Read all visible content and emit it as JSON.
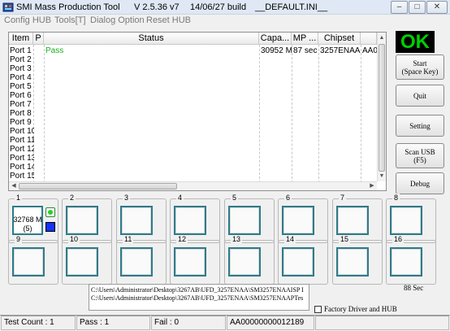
{
  "window": {
    "title": "SMI Mass Production Tool",
    "version": "V 2.5.36  v7",
    "build": "14/06/27 build",
    "ini": "__DEFAULT.INI__"
  },
  "menu": [
    "Config HUB",
    "Tools[T]",
    "Dialog Option",
    "Reset HUB"
  ],
  "table": {
    "headers": [
      "Item",
      "P",
      "Status",
      "Capa...",
      "MP ...",
      "Chipset",
      "▲"
    ],
    "ports": [
      "Port 1",
      "Port 2",
      "Port 3",
      "Port 4",
      "Port 5",
      "Port 6",
      "Port 7",
      "Port 8",
      "Port 9",
      "Port 10",
      "Port 11",
      "Port 12",
      "Port 13",
      "Port 14",
      "Port 15"
    ],
    "row1": {
      "status": "Pass",
      "capacity": "30952 M",
      "mp_time": "87 sec",
      "chipset": "3257ENAA",
      "extra": "AA0"
    }
  },
  "result": {
    "text": "OK",
    "color": "#00d000"
  },
  "buttons": {
    "start": "Start\n(Space Key)",
    "quit": "Quit",
    "setting": "Setting",
    "scan": "Scan USB\n(F5)",
    "debug": "Debug"
  },
  "groups": [
    "1",
    "2",
    "3",
    "4",
    "5",
    "6",
    "7",
    "8",
    "9",
    "10",
    "11",
    "12",
    "13",
    "14",
    "15",
    "16"
  ],
  "slot1": {
    "capacity": "32768 M",
    "time": "(5)"
  },
  "info_lines": [
    "C:\\Users\\Administrator\\Desktop\\3267AB\\UFD_3257ENAA\\SM3257ENAAISP I",
    "C:\\Users\\Administrator\\Desktop\\3267AB\\UFD_3257ENAA\\SM3257ENAAPTes"
  ],
  "seconds": "88 Sec",
  "factory_driver": "Factory Driver and HUB",
  "status_bar": {
    "test_count": "Test Count : 1",
    "pass": "Pass : 1",
    "fail": "Fail : 0",
    "serial": "AA00000000012189"
  }
}
